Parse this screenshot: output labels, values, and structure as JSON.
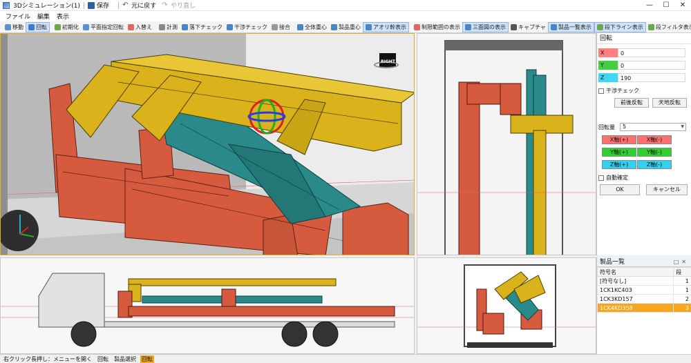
{
  "window": {
    "title": "3Dシミュレーション(1)",
    "quick_access": {
      "save": "保存",
      "undo": "元に戻す",
      "redo": "やり直し"
    },
    "controls": {
      "minimize": "—",
      "maximize": "☐",
      "close": "✕"
    }
  },
  "menu": [
    "ファイル",
    "編集",
    "表示"
  ],
  "toolbar": [
    {
      "label": "移動",
      "active": false,
      "color": "#5b8fd0"
    },
    {
      "label": "回転",
      "active": true,
      "color": "#3d7cc9"
    },
    {
      "label": "初期化",
      "active": false,
      "color": "#6aa84f"
    },
    {
      "label": "平面指定回転",
      "active": false,
      "color": "#5b8fd0"
    },
    {
      "label": "入替え",
      "active": false,
      "color": "#e06666"
    },
    {
      "label": "計測",
      "active": false,
      "color": "#888888"
    },
    {
      "label": "落下チェック",
      "active": false,
      "color": "#4a86c5"
    },
    {
      "label": "干渉チェック",
      "active": false,
      "color": "#4a86c5"
    },
    {
      "label": "接合",
      "active": false,
      "color": "#999999"
    },
    {
      "label": "全体重心",
      "active": false,
      "color": "#4a86c5"
    },
    {
      "label": "製品重心",
      "active": false,
      "color": "#4a86c5"
    },
    {
      "label": "アオリ幹表示",
      "active": true,
      "color": "#4a86c5"
    },
    {
      "label": "制限範囲の表示",
      "active": false,
      "color": "#e06666"
    },
    {
      "label": "三面図の表示",
      "active": true,
      "color": "#4a86c5"
    },
    {
      "label": "キャプチャ",
      "active": false,
      "color": "#555555"
    },
    {
      "label": "製品一覧表示",
      "active": true,
      "color": "#4a86c5"
    },
    {
      "label": "段下ライン表示",
      "active": true,
      "color": "#6aa84f"
    },
    {
      "label": "段フィルタ表示",
      "active": false,
      "color": "#6aa84f"
    }
  ],
  "viewport": {
    "view_cube_label": "RIGHT"
  },
  "rotation_panel": {
    "title": "回転",
    "axes": [
      {
        "label": "X",
        "value": "0",
        "color": "#ff8080"
      },
      {
        "label": "Y",
        "value": "0",
        "color": "#40d040"
      },
      {
        "label": "Z",
        "value": "190",
        "color": "#40d8f0"
      }
    ],
    "collision_check": "干渉チェック",
    "flip_fb": "前後反転",
    "flip_tb": "天地反転",
    "amount_label": "回転量",
    "amount_value": "5",
    "axis_buttons": [
      {
        "label": "X軸(+)",
        "color": "#ff7070"
      },
      {
        "label": "X軸(-)",
        "color": "#ff7070"
      },
      {
        "label": "Y軸(+)",
        "color": "#30d030"
      },
      {
        "label": "Y軸(-)",
        "color": "#30d030"
      },
      {
        "label": "Z軸(+)",
        "color": "#30d0f0"
      },
      {
        "label": "Z軸(-)",
        "color": "#30d0f0"
      }
    ],
    "auto_confirm": "自動確定",
    "ok": "OK",
    "cancel": "キャンセル"
  },
  "product_list": {
    "title": "製品一覧",
    "columns": [
      "符号名",
      "段"
    ],
    "rows": [
      {
        "name": "[符号なし]",
        "tier": "1",
        "selected": false
      },
      {
        "name": "1CK1KC403",
        "tier": "1",
        "selected": false
      },
      {
        "name": "1CK3KD157",
        "tier": "2",
        "selected": false
      },
      {
        "name": "1CK4KD358",
        "tier": "3",
        "selected": true
      }
    ]
  },
  "status_bar": {
    "hint": "右クリック長押し：メニューを開く",
    "items": [
      "回転",
      "製品選択"
    ],
    "mode": "回転"
  },
  "colors": {
    "red_part": "#d65a3e",
    "teal_part": "#2a8a8a",
    "yellow_part": "#d9b21c",
    "selection": "#f5a623"
  }
}
